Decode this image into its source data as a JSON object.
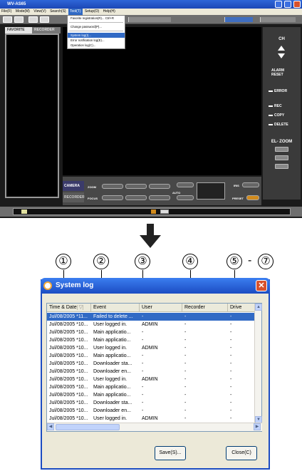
{
  "app": {
    "title": "WV-AS65",
    "menu": [
      "File(F)",
      "Mode(M)",
      "View(V)",
      "Search(S)",
      "Tool(T)",
      "Setup(O)",
      "Help(H)"
    ],
    "active_menu_index": 4,
    "tool_menu_items": [
      "Favorite registration(R)...    Ctrl+R",
      "Change password(P)...",
      "System log(I)...",
      "Error notification log(E)...",
      "Operation log(C)..."
    ],
    "highlighted_menu_item_index": 2,
    "tabs": [
      "FAVORITE",
      "RECORDER"
    ],
    "right_panel": {
      "ch": "CH",
      "alarm_reset": "ALARM RESET",
      "error": "ERROR",
      "rec": "REC",
      "copy": "COPY",
      "delete": "DELETE",
      "el_zoom": "EL- ZOOM"
    },
    "control_panel": {
      "camera_tab": "CAMERA",
      "recorder_tab": "RECORDER",
      "zoom": "ZOOM",
      "focus": "FOCUS",
      "auto": "AUTO",
      "iris": "IRIS",
      "preset": "PRESET"
    }
  },
  "callouts": [
    "①",
    "②",
    "③",
    "④",
    "⑤",
    "⑦"
  ],
  "callout_dash": "-",
  "dialog": {
    "title": "System log",
    "close_glyph": "✕",
    "columns": [
      "Time & Date",
      "Event",
      "User",
      "Recorder",
      "Drive"
    ],
    "sort_indicator": "▽",
    "rows": [
      {
        "time": "Jul/08/2005 *11...",
        "event": "Failed to delete ...",
        "user": "-",
        "recorder": "-",
        "drive": "-"
      },
      {
        "time": "Jul/08/2005 *10...",
        "event": "User logged in.",
        "user": "ADMIN",
        "recorder": "-",
        "drive": "-"
      },
      {
        "time": "Jul/08/2005 *10...",
        "event": "Main applicatio...",
        "user": "-",
        "recorder": "-",
        "drive": "-"
      },
      {
        "time": "Jul/08/2005 *10...",
        "event": "Main applicatio...",
        "user": "-",
        "recorder": "-",
        "drive": "-"
      },
      {
        "time": "Jul/08/2005 *10...",
        "event": "User logged in.",
        "user": "ADMIN",
        "recorder": "-",
        "drive": "-"
      },
      {
        "time": "Jul/08/2005 *10...",
        "event": "Main applicatio...",
        "user": "-",
        "recorder": "-",
        "drive": "-"
      },
      {
        "time": "Jul/08/2005 *10...",
        "event": "Downloader sta...",
        "user": "-",
        "recorder": "-",
        "drive": "-"
      },
      {
        "time": "Jul/08/2005 *10...",
        "event": "Downloader en...",
        "user": "-",
        "recorder": "-",
        "drive": "-"
      },
      {
        "time": "Jul/08/2005 *10...",
        "event": "User logged in.",
        "user": "ADMIN",
        "recorder": "-",
        "drive": "-"
      },
      {
        "time": "Jul/08/2005 *10...",
        "event": "Main applicatio...",
        "user": "-",
        "recorder": "-",
        "drive": "-"
      },
      {
        "time": "Jul/08/2005 *10...",
        "event": "Main applicatio...",
        "user": "-",
        "recorder": "-",
        "drive": "-"
      },
      {
        "time": "Jul/08/2005 *10...",
        "event": "Downloader sta...",
        "user": "-",
        "recorder": "-",
        "drive": "-"
      },
      {
        "time": "Jul/08/2005 *10...",
        "event": "Downloader en...",
        "user": "-",
        "recorder": "-",
        "drive": "-"
      },
      {
        "time": "Jul/08/2005 *10...",
        "event": "User logged in.",
        "user": "ADMIN",
        "recorder": "-",
        "drive": "-"
      },
      {
        "time": "Jul/08/2005 *10...",
        "event": "Main applicatio...",
        "user": "-",
        "recorder": "-",
        "drive": "-"
      }
    ],
    "save_button": "Save(S)...",
    "close_button": "Close(C)"
  },
  "colors": {
    "selection": "#316ac5",
    "title_bar": "#1c4cc2",
    "app_background": "#1b1b1b"
  }
}
